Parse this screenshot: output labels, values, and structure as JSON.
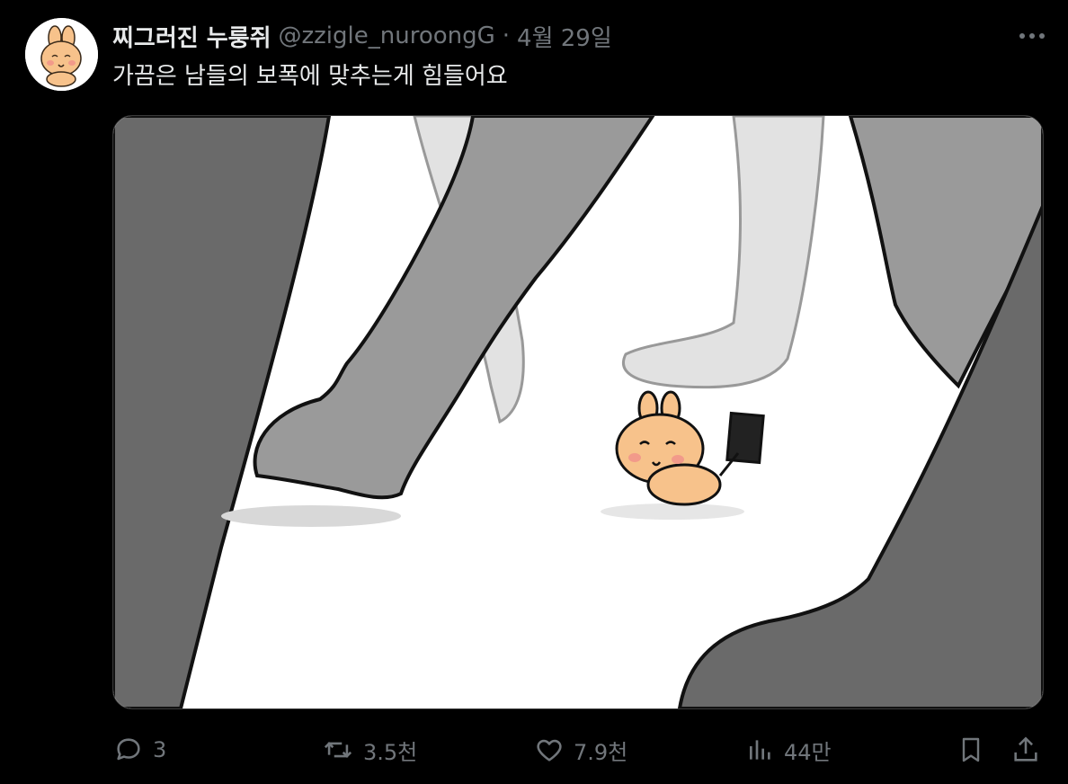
{
  "tweet": {
    "display_name": "찌그러진 누룽쥐",
    "handle": "@zzigle_nuroongG",
    "separator": "·",
    "date": "4월 29일",
    "text": "가끔은 남들의 보폭에 맞추는게 힘들어요"
  },
  "header": {
    "more_icon": "more-horizontal-icon"
  },
  "media": {
    "description_icon": "illustration",
    "colors": {
      "leg_dark": "#6a6a6a",
      "leg_mid": "#9a9a9a",
      "leg_light": "#e2e2e2",
      "ground": "#ffffff",
      "bunny": "#f7c28b"
    }
  },
  "actions": {
    "reply": {
      "icon": "reply-icon",
      "count": "3"
    },
    "retweet": {
      "icon": "retweet-icon",
      "count": "3.5천"
    },
    "like": {
      "icon": "heart-icon",
      "count": "7.9천"
    },
    "views": {
      "icon": "views-icon",
      "count": "44만"
    },
    "bookmark": {
      "icon": "bookmark-icon"
    },
    "share": {
      "icon": "share-icon"
    }
  },
  "colors": {
    "background": "#000000",
    "text_primary": "#e7e9ea",
    "text_secondary": "#71767b"
  }
}
